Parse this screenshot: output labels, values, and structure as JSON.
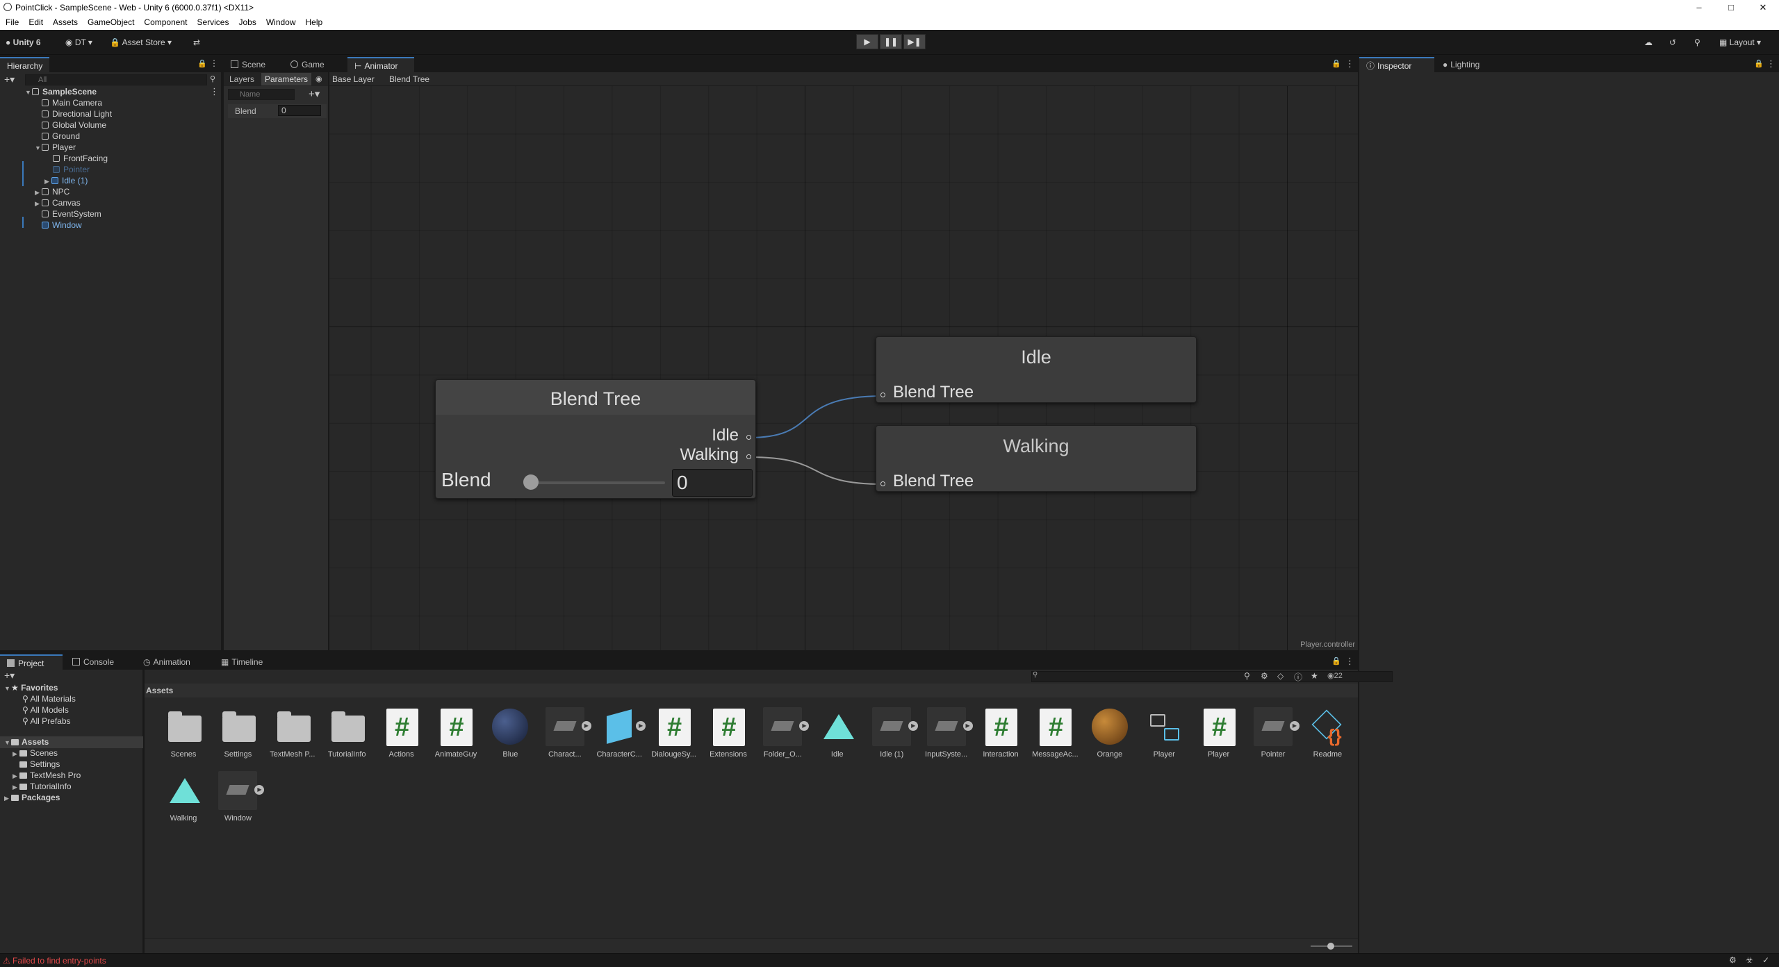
{
  "window": {
    "title": "PointClick - SampleScene - Web - Unity 6 (6000.0.37f1) <DX11>"
  },
  "menu": [
    "File",
    "Edit",
    "Assets",
    "GameObject",
    "Component",
    "Services",
    "Jobs",
    "Window",
    "Help"
  ],
  "toolbar": {
    "unity": "Unity 6",
    "account": "DT",
    "asset_store": "Asset Store",
    "layout": "Layout"
  },
  "hierarchy": {
    "tab": "Hierarchy",
    "search_placeholder": "All",
    "scene": "SampleScene",
    "items": [
      "Main Camera",
      "Directional Light",
      "Global Volume",
      "Ground",
      "Player",
      "FrontFacing",
      "Pointer",
      "Idle (1)",
      "NPC",
      "Canvas",
      "EventSystem",
      "Window"
    ]
  },
  "center_tabs": {
    "scene": "Scene",
    "game": "Game",
    "animator": "Animator"
  },
  "animator": {
    "layers": "Layers",
    "parameters": "Parameters",
    "name_placeholder": "Name",
    "breadcrumb": [
      "Base Layer",
      "Blend Tree"
    ],
    "param": {
      "name": "Blend",
      "value": "0"
    },
    "footer": "Player.controller",
    "blend_tree": {
      "title": "Blend Tree",
      "out1": "Idle",
      "out2": "Walking",
      "param": "Blend",
      "value": "0",
      "slider_value": 0
    },
    "idle_node": {
      "title": "Idle",
      "input": "Blend Tree"
    },
    "walking_node": {
      "title": "Walking",
      "input": "Blend Tree"
    }
  },
  "right_tabs": {
    "inspector": "Inspector",
    "lighting": "Lighting"
  },
  "bottom_tabs": {
    "project": "Project",
    "console": "Console",
    "animation": "Animation",
    "timeline": "Timeline"
  },
  "project": {
    "favorites": "Favorites",
    "fav_items": [
      "All Materials",
      "All Models",
      "All Prefabs"
    ],
    "assets_root": "Assets",
    "asset_folders": [
      "Scenes",
      "Settings",
      "TextMesh Pro",
      "TutorialInfo"
    ],
    "packages": "Packages",
    "breadcrumb": "Assets",
    "count": "22",
    "assets": [
      {
        "name": "Scenes",
        "type": "folder"
      },
      {
        "name": "Settings",
        "type": "folder"
      },
      {
        "name": "TextMesh P...",
        "type": "folder"
      },
      {
        "name": "TutorialInfo",
        "type": "folder"
      },
      {
        "name": "Actions",
        "type": "script"
      },
      {
        "name": "AnimateGuy",
        "type": "script"
      },
      {
        "name": "Blue",
        "type": "material-blue"
      },
      {
        "name": "Charact...",
        "type": "prefab"
      },
      {
        "name": "CharacterC...",
        "type": "cube"
      },
      {
        "name": "DialougeSy...",
        "type": "script"
      },
      {
        "name": "Extensions",
        "type": "script"
      },
      {
        "name": "Folder_O...",
        "type": "prefab"
      },
      {
        "name": "Idle",
        "type": "anim"
      },
      {
        "name": "Idle (1)",
        "type": "prefab"
      },
      {
        "name": "InputSyste...",
        "type": "prefab"
      },
      {
        "name": "Interaction",
        "type": "script"
      },
      {
        "name": "MessageAc...",
        "type": "script"
      },
      {
        "name": "Orange",
        "type": "material-orange"
      },
      {
        "name": "Player",
        "type": "controller"
      },
      {
        "name": "Player",
        "type": "script"
      },
      {
        "name": "Pointer",
        "type": "prefab"
      },
      {
        "name": "Readme",
        "type": "readme"
      },
      {
        "name": "Walking",
        "type": "anim"
      },
      {
        "name": "Window",
        "type": "prefab"
      }
    ]
  },
  "status": {
    "error": "Failed to find entry-points"
  },
  "colors": {
    "accent": "#3a79bb",
    "error": "#e04848",
    "bg": "#282828"
  }
}
